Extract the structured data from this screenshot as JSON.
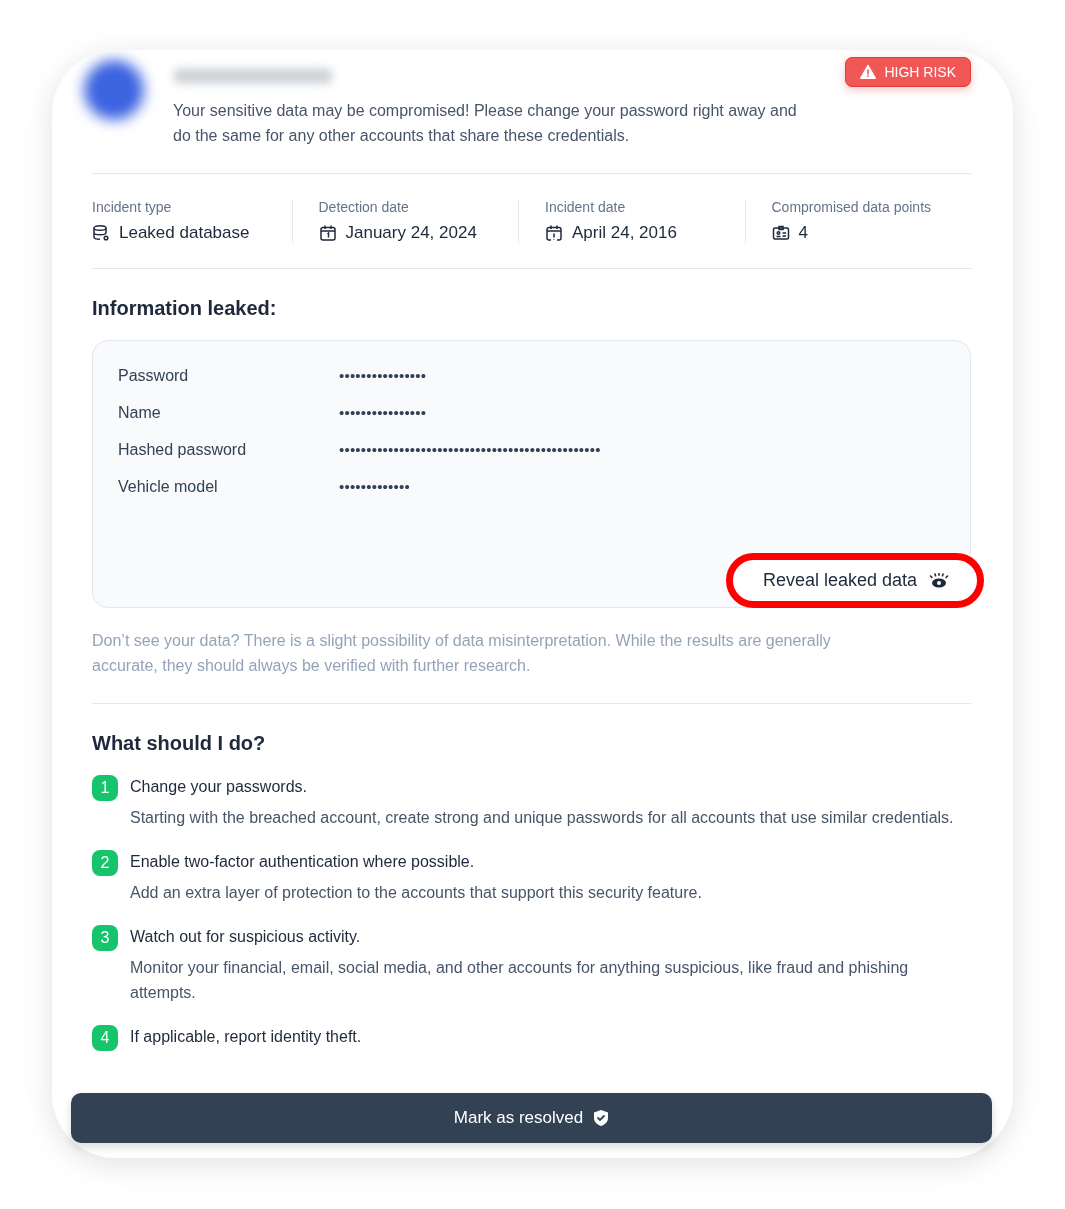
{
  "risk_badge": {
    "label": "HIGH RISK"
  },
  "message": "Your sensitive data may be compromised! Please change your password right away and do the same for any other accounts that share these credentials.",
  "details": [
    {
      "kind": "database",
      "label": "Incident type",
      "value": "Leaked database"
    },
    {
      "kind": "calendar",
      "label": "Detection date",
      "value": "January 24, 2024"
    },
    {
      "kind": "calendar-alert",
      "label": "Incident date",
      "value": "April 24, 2016"
    },
    {
      "kind": "id-card",
      "label": "Compromised data points",
      "value": "4"
    }
  ],
  "leaked_heading": "Information leaked:",
  "leaked_rows": [
    {
      "label": "Password",
      "value": "••••••••••••••••"
    },
    {
      "label": "Name",
      "value": "••••••••••••••••"
    },
    {
      "label": "Hashed password",
      "value": "••••••••••••••••••••••••••••••••••••••••••••••••"
    },
    {
      "label": "Vehicle model",
      "value": "•••••••••••••"
    }
  ],
  "reveal_button": {
    "label": "Reveal leaked data"
  },
  "note": "Don’t see your data? There is a slight possibility of data misinterpretation. While the results are generally accurate, they should always be verified with further research.",
  "steps_heading": "What should I do?",
  "steps": [
    {
      "number": "1",
      "title": "Change your passwords.",
      "text": "Starting with the breached account, create strong and unique passwords for all accounts that use similar credentials."
    },
    {
      "number": "2",
      "title": "Enable two-factor authentication where possible.",
      "text": "Add an extra layer of protection to the accounts that support this security feature."
    },
    {
      "number": "3",
      "title": "Watch out for suspicious activity.",
      "text": "Monitor your financial, email, social media, and other accounts for anything suspicious, like fraud and phishing attempts."
    },
    {
      "number": "4",
      "title": "If applicable, report identity theft."
    }
  ],
  "resolve_button": {
    "label": "Mark as resolved"
  }
}
